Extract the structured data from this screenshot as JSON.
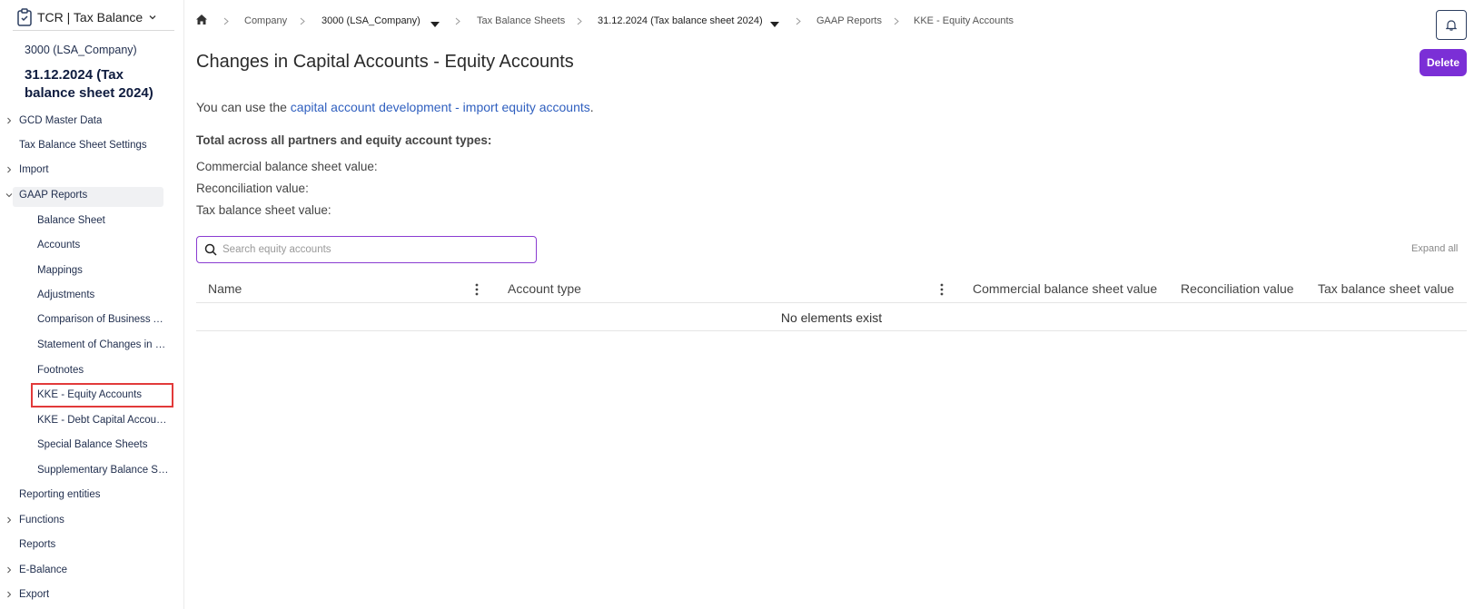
{
  "app": {
    "title": "TCR | Tax Balance"
  },
  "sidebar": {
    "company": "3000 (LSA_Company)",
    "balance_sheet": "31.12.2024 (Tax balance sheet 2024)",
    "items": [
      {
        "label": "GCD Master Data"
      },
      {
        "label": "Tax Balance Sheet Settings"
      },
      {
        "label": "Import"
      },
      {
        "label": "GAAP Reports"
      },
      {
        "label": "Reporting entities"
      },
      {
        "label": "Functions"
      },
      {
        "label": "Reports"
      },
      {
        "label": "E-Balance"
      },
      {
        "label": "Export"
      }
    ],
    "subitems": [
      {
        "label": "Balance Sheet"
      },
      {
        "label": "Accounts"
      },
      {
        "label": "Mappings"
      },
      {
        "label": "Adjustments"
      },
      {
        "label": "Comparison of Business Assets"
      },
      {
        "label": "Statement of Changes in Fixed Assets"
      },
      {
        "label": "Footnotes"
      },
      {
        "label": "KKE - Equity Accounts"
      },
      {
        "label": "KKE - Debt Capital Accounts"
      },
      {
        "label": "Special Balance Sheets"
      },
      {
        "label": "Supplementary Balance Sheets"
      }
    ]
  },
  "breadcrumb": {
    "company": "Company",
    "company_value": "3000 (LSA_Company)",
    "tax_balance_sheets": "Tax Balance Sheets",
    "sheet_value": "31.12.2024 (Tax balance sheet 2024)",
    "gaap_reports": "GAAP Reports",
    "current": "KKE - Equity Accounts"
  },
  "header": {
    "delete_label": "Delete"
  },
  "main": {
    "title": "Changes in Capital Accounts - Equity Accounts",
    "info_prefix": "You can use the ",
    "info_link": "capital account development - import equity accounts",
    "info_suffix": ".",
    "total_heading": "Total across all partners and equity account types:",
    "commercial_label": "Commercial balance sheet value:",
    "reconciliation_label": "Reconciliation value:",
    "tax_label": "Tax balance sheet value:",
    "search_placeholder": "Search equity accounts",
    "expand_all": "Expand all",
    "columns": [
      "Name",
      "Account type",
      "Commercial balance sheet value",
      "Reconciliation value",
      "Tax balance sheet value"
    ],
    "empty_text": "No elements exist"
  },
  "colors": {
    "accent": "#7b2fd6",
    "link": "#2f5fbf",
    "highlight": "#e23a3a"
  }
}
